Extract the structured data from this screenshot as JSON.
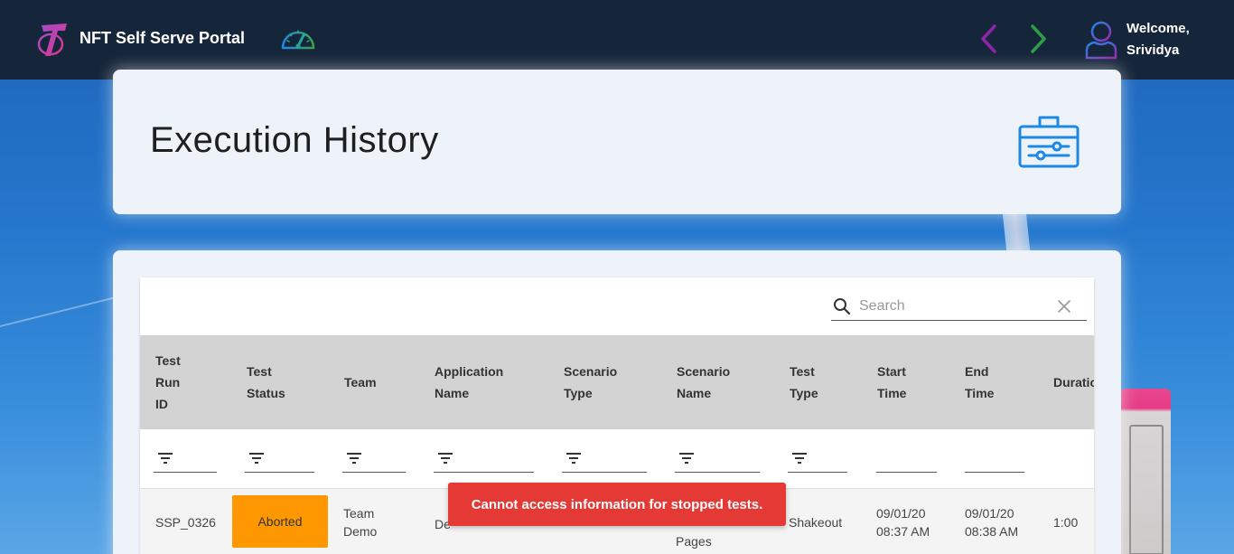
{
  "header": {
    "brand_title": "NFT Self Serve Portal",
    "welcome_line1": "Welcome,",
    "welcome_line2": "Srividya"
  },
  "icons": {
    "brand": "telstra-logo-icon",
    "dashboard": "speedometer-icon",
    "prev": "chevron-left-icon",
    "next": "chevron-right-icon",
    "user": "user-avatar-icon",
    "page": "toolbox-icon",
    "search": "search-icon",
    "clear": "close-icon",
    "filter": "filter-icon"
  },
  "colors": {
    "topbar": "#16263a",
    "nav_prev": "#8e24aa",
    "nav_next": "#2e9e44",
    "status_aborted": "#ff9800",
    "toast": "#e53935",
    "page_icon": "#1e88e5"
  },
  "page": {
    "title": "Execution History"
  },
  "search": {
    "placeholder": "Search",
    "value": ""
  },
  "table": {
    "columns": [
      {
        "line1": "Test",
        "line2": "Run",
        "line3": "ID"
      },
      {
        "line1": "Test",
        "line2": "Status",
        "line3": ""
      },
      {
        "line1": "Team",
        "line2": "",
        "line3": ""
      },
      {
        "line1": "Application",
        "line2": "Name",
        "line3": ""
      },
      {
        "line1": "Scenario",
        "line2": "Type",
        "line3": ""
      },
      {
        "line1": "Scenario",
        "line2": "Name",
        "line3": ""
      },
      {
        "line1": "Test",
        "line2": "Type",
        "line3": ""
      },
      {
        "line1": "Start",
        "line2": "Time",
        "line3": ""
      },
      {
        "line1": "End",
        "line2": "Time",
        "line3": ""
      },
      {
        "line1": "Duratio",
        "line2": "",
        "line3": ""
      }
    ],
    "rows": [
      {
        "test_run_id": "SSP_0326",
        "test_status": "Aborted",
        "team_line1": "Team",
        "team_line2": "Demo",
        "application_name": "De",
        "scenario_name": "Pages",
        "test_type": "Shakeout",
        "start_line1": "09/01/20",
        "start_line2": "08:37 AM",
        "end_line1": "09/01/20",
        "end_line2": "08:38 AM",
        "duration": "1:00"
      }
    ]
  },
  "toast": {
    "message": "Cannot access information for stopped tests."
  }
}
